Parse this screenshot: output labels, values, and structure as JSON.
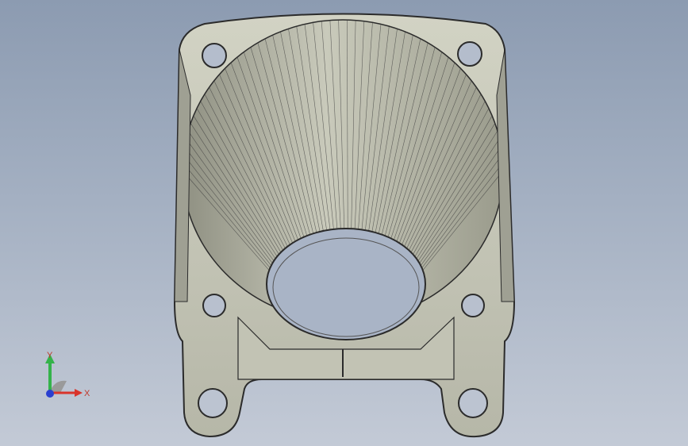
{
  "viewport": {
    "background_top": "#8c9bb1",
    "background_bottom": "#c3cad6"
  },
  "model": {
    "body_color": "#c7c8b8",
    "cone_color": "#b4b5a6",
    "edge_color": "#2b2b2b",
    "bore_color": "#a9b4c6"
  },
  "triad": {
    "x_label": "X",
    "y_label": "Y",
    "x_color": "#d9342b",
    "y_color": "#34b34a",
    "z_color": "#2a3fd0"
  }
}
